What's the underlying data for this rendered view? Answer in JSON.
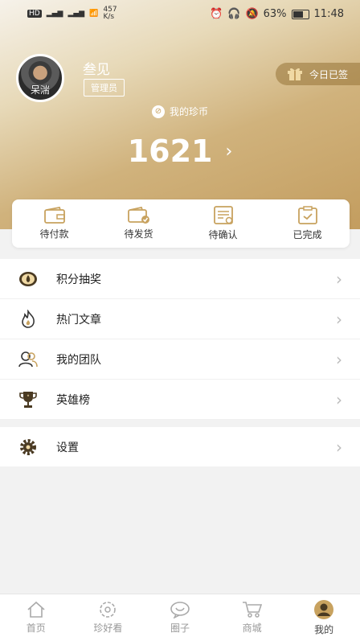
{
  "status": {
    "network": "HD",
    "speed": "457\nK/s",
    "battery": "63%",
    "time": "11:48"
  },
  "profile": {
    "avatar_text": "呆湍",
    "greeting": "叁见",
    "role": "管理员",
    "checkin_label": "今日已签",
    "coin_label": "我的珍币",
    "coins": "1621"
  },
  "orders": [
    {
      "label": "待付款",
      "icon": "wallet-icon"
    },
    {
      "label": "待发货",
      "icon": "shipping-icon"
    },
    {
      "label": "待确认",
      "icon": "document-icon"
    },
    {
      "label": "已完成",
      "icon": "clipboard-check-icon"
    }
  ],
  "menu": [
    {
      "label": "积分抽奖",
      "icon": "lottery-icon"
    },
    {
      "label": "热门文章",
      "icon": "fire-icon"
    },
    {
      "label": "我的团队",
      "icon": "team-icon"
    },
    {
      "label": "英雄榜",
      "icon": "trophy-icon"
    }
  ],
  "settings": {
    "label": "设置",
    "icon": "gear-icon"
  },
  "tabs": [
    {
      "label": "首页",
      "icon": "home-icon"
    },
    {
      "label": "珍好看",
      "icon": "flower-icon"
    },
    {
      "label": "圈子",
      "icon": "chat-icon"
    },
    {
      "label": "商城",
      "icon": "cart-icon"
    },
    {
      "label": "我的",
      "icon": "profile-icon",
      "active": true
    }
  ],
  "colors": {
    "accent": "#c8a25f",
    "header_dark": "#c39d5f"
  }
}
